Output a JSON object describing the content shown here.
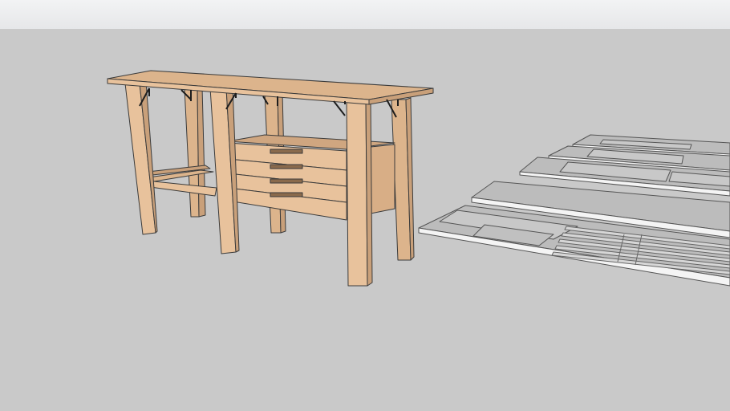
{
  "viewer": {
    "colors": {
      "sky": "#eceded",
      "ground": "#c9c9c9",
      "wood_top": "#dcb48c",
      "wood_face": "#e8c29c",
      "wood_side": "#c9a07a",
      "edge": "#3b3b3b",
      "bracket": "#1e1e1e",
      "panel_light": "#d6d6d6",
      "panel_mid": "#bcbcbc",
      "panel_edge": "#f4f4f4"
    },
    "model": {
      "workbench": {
        "drawer_count": 4,
        "legs": 6,
        "brackets": 6
      },
      "cut_parts": {
        "panel_count": 6
      }
    }
  }
}
